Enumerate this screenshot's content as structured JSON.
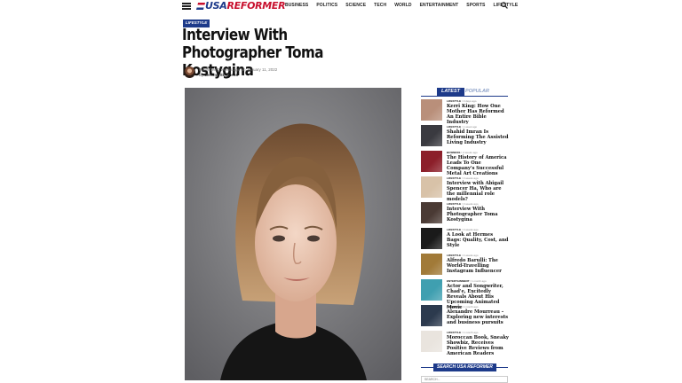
{
  "header": {
    "logo_usa": "USA",
    "logo_reformer": "REFORMER",
    "nav": [
      "BUSINESS",
      "POLITICS",
      "SCIENCE",
      "TECH",
      "WORLD",
      "ENTERTAINMENT",
      "SPORTS",
      "LIFESTYLE"
    ]
  },
  "article": {
    "category": "LIFESTYLE",
    "title": "Interview With Photographer Toma Kostygina",
    "published": "Published 3 weeks ago on January 11, 2022",
    "by_prefix": "By",
    "author": "Jerome Stephens"
  },
  "sidebar": {
    "tab_latest": "LATEST",
    "tab_popular": "POPULAR",
    "items": [
      {
        "category": "LIFESTYLE",
        "time": "3 days ago",
        "headline": "Kerri King: How One Mother Has Reformed An Entire Bible Industry",
        "thumb": "#b98f7a"
      },
      {
        "category": "LIFESTYLE",
        "time": "1 week ago",
        "headline": "Shahid Imran Is Reforming The Assisted Living Industry",
        "thumb": "#3a3a40"
      },
      {
        "category": "BUSINESS",
        "time": "2 weeks ago",
        "headline": "The History of America Leads To One Company's Successful Metal Art Creations",
        "thumb": "#8c1f2a"
      },
      {
        "category": "LIFESTYLE",
        "time": "3 weeks ago",
        "headline": "Interview with Abigail Spencer Ha, Who are the millennial role models?",
        "thumb": "#d8c2a8"
      },
      {
        "category": "LIFESTYLE",
        "time": "3 weeks ago",
        "headline": "Interview With Photographer Toma Kostygina",
        "thumb": "#4a3a34"
      },
      {
        "category": "LIFESTYLE",
        "time": "3 weeks ago",
        "headline": "A Look at Hermes Bags: Quality, Cost, and Style",
        "thumb": "#1a1a1a"
      },
      {
        "category": "LIFESTYLE",
        "time": "4 weeks ago",
        "headline": "Alfredo Barulli: The World-Travelling Instagram Influencer",
        "thumb": "#a17a38"
      },
      {
        "category": "ENTERTAINMENT",
        "time": "1 month ago",
        "headline": "Actor and Songwriter, Chad'e, Excitedly Reveals About His Upcoming Animated Movie",
        "thumb": "#3f9fb0"
      },
      {
        "category": "LIFESTYLE",
        "time": "1 month ago",
        "headline": "Alexandre Mourreau – Exploring new interests and business pursuits",
        "thumb": "#2c3a4e"
      },
      {
        "category": "LIFESTYLE",
        "time": "1 month ago",
        "headline": "Moroccan Book, Sneaky Showbiz, Receives Positive Reviews from American Readers",
        "thumb": "#e9e4de"
      }
    ],
    "search_title": "SEARCH USA REFORMER",
    "search_placeholder": "SEARCH..."
  }
}
